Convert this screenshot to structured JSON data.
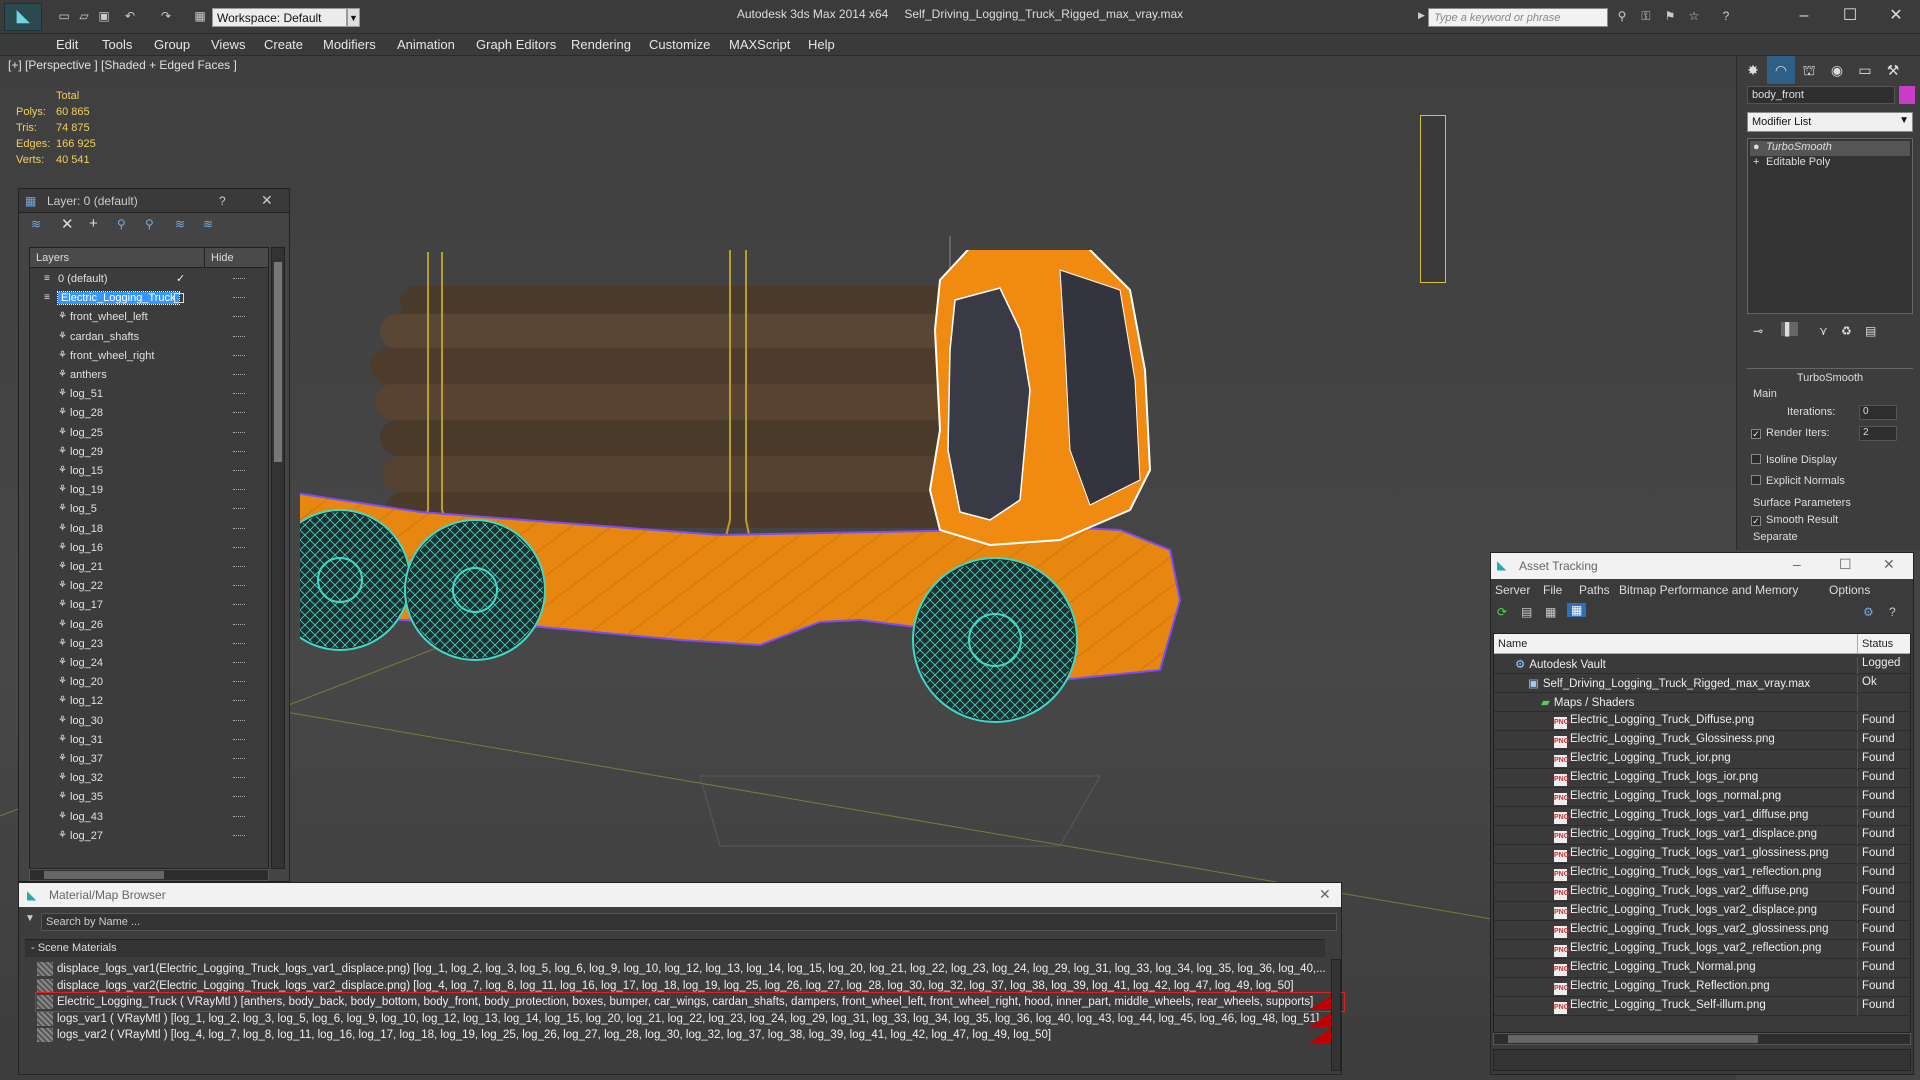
{
  "app": {
    "name": "Autodesk 3ds Max  2014 x64",
    "file": "Self_Driving_Logging_Truck_Rigged_max_vray.max",
    "workspace": "Workspace: Default",
    "search_placeholder": "Type a keyword or phrase"
  },
  "menu": [
    "Edit",
    "Tools",
    "Group",
    "Views",
    "Create",
    "Modifiers",
    "Animation",
    "Graph Editors",
    "Rendering",
    "Customize",
    "MAXScript",
    "Help"
  ],
  "viewport": {
    "label": "[+] [Perspective ] [Shaded + Edged Faces ]",
    "stats": {
      "header": "Total",
      "rows": [
        {
          "k": "Polys:",
          "v": "60 865"
        },
        {
          "k": "Tris:",
          "v": "74 875"
        },
        {
          "k": "Edges:",
          "v": "166 925"
        },
        {
          "k": "Verts:",
          "v": "40 541"
        }
      ]
    }
  },
  "command_panel": {
    "object_name": "body_front",
    "object_color": "#c83ec8",
    "modifier_list": "Modifier List",
    "stack": [
      "TurboSmooth",
      "Editable Poly"
    ],
    "rollout": "TurboSmooth",
    "main_label": "Main",
    "iterations_label": "Iterations:",
    "iterations": "0",
    "render_iters_label": "Render Iters:",
    "render_iters": "2",
    "isoline": "Isoline Display",
    "explicit": "Explicit Normals",
    "surface_label": "Surface Parameters",
    "smooth_result": "Smooth Result",
    "separate": "Separate"
  },
  "layer_panel": {
    "title": "Layer: 0 (default)",
    "help": "?",
    "col_layers": "Layers",
    "col_hide": "Hide",
    "rows": [
      {
        "name": "0 (default)",
        "level": 0,
        "selected": false,
        "check": true
      },
      {
        "name": "Electric_Logging_Truck",
        "level": 0,
        "selected": true,
        "check": false
      },
      {
        "name": "front_wheel_left",
        "level": 1
      },
      {
        "name": "cardan_shafts",
        "level": 1
      },
      {
        "name": "front_wheel_right",
        "level": 1
      },
      {
        "name": "anthers",
        "level": 1
      },
      {
        "name": "log_51",
        "level": 1
      },
      {
        "name": "log_28",
        "level": 1
      },
      {
        "name": "log_25",
        "level": 1
      },
      {
        "name": "log_29",
        "level": 1
      },
      {
        "name": "log_15",
        "level": 1
      },
      {
        "name": "log_19",
        "level": 1
      },
      {
        "name": "log_5",
        "level": 1
      },
      {
        "name": "log_18",
        "level": 1
      },
      {
        "name": "log_16",
        "level": 1
      },
      {
        "name": "log_21",
        "level": 1
      },
      {
        "name": "log_22",
        "level": 1
      },
      {
        "name": "log_17",
        "level": 1
      },
      {
        "name": "log_26",
        "level": 1
      },
      {
        "name": "log_23",
        "level": 1
      },
      {
        "name": "log_24",
        "level": 1
      },
      {
        "name": "log_20",
        "level": 1
      },
      {
        "name": "log_12",
        "level": 1
      },
      {
        "name": "log_30",
        "level": 1
      },
      {
        "name": "log_31",
        "level": 1
      },
      {
        "name": "log_37",
        "level": 1
      },
      {
        "name": "log_32",
        "level": 1
      },
      {
        "name": "log_35",
        "level": 1
      },
      {
        "name": "log_43",
        "level": 1
      },
      {
        "name": "log_27",
        "level": 1
      }
    ]
  },
  "material_browser": {
    "title": "Material/Map Browser",
    "search_placeholder": "Search by Name ...",
    "section": "- Scene Materials",
    "rows": [
      {
        "text": "displace_logs_var1(Electric_Logging_Truck_logs_var1_displace.png) [log_1, log_2, log_3, log_5, log_6, log_9, log_10, log_12, log_13, log_14, log_15, log_20, log_21, log_22, log_23, log_24, log_29, log_31, log_33, log_34, log_35, log_36, log_40,...",
        "highlight": false
      },
      {
        "text": "displace_logs_var2(Electric_Logging_Truck_logs_var2_displace.png) [log_4, log_7, log_8, log_11, log_16, log_17, log_18, log_19, log_25, log_26, log_27, log_28, log_30, log_32, log_37, log_38, log_39, log_41, log_42, log_47, log_49, log_50]",
        "highlight": false
      },
      {
        "text": "Electric_Logging_Truck ( VRayMtl ) [anthers, body_back, body_bottom, body_front, body_protection, boxes, bumper, car_wings, cardan_shafts, dampers, front_wheel_left, front_wheel_right, hood, inner_part, middle_wheels, rear_wheels, supports]",
        "highlight": true
      },
      {
        "text": "logs_var1 ( VRayMtl ) [log_1, log_2, log_3, log_5, log_6, log_9, log_10, log_12, log_13, log_14, log_15, log_20, log_21, log_22, log_23, log_24, log_29, log_31, log_33, log_34, log_35, log_36, log_40, log_43, log_44, log_45, log_46, log_48, log_51]",
        "highlight": false
      },
      {
        "text": "logs_var2 ( VRayMtl ) [log_4, log_7, log_8, log_11, log_16, log_17, log_18, log_19, log_25, log_26, log_27, log_28, log_30, log_32, log_37, log_38, log_39, log_41, log_42, log_47, log_49, log_50]",
        "highlight": false
      }
    ]
  },
  "asset_tracking": {
    "title": "Asset Tracking",
    "menu": [
      "Server",
      "File",
      "Paths",
      "Bitmap Performance and Memory",
      "Options"
    ],
    "col_name": "Name",
    "col_status": "Status",
    "rows": [
      {
        "name": "Autodesk Vault",
        "status": "Logged",
        "indent": 1,
        "icon": "vault"
      },
      {
        "name": "Self_Driving_Logging_Truck_Rigged_max_vray.max",
        "status": "Ok",
        "indent": 2,
        "icon": "max"
      },
      {
        "name": "Maps / Shaders",
        "status": "",
        "indent": 3,
        "icon": "folder"
      },
      {
        "name": "Electric_Logging_Truck_Diffuse.png",
        "status": "Found",
        "indent": 4,
        "icon": "png"
      },
      {
        "name": "Electric_Logging_Truck_Glossiness.png",
        "status": "Found",
        "indent": 4,
        "icon": "png"
      },
      {
        "name": "Electric_Logging_Truck_ior.png",
        "status": "Found",
        "indent": 4,
        "icon": "png"
      },
      {
        "name": "Electric_Logging_Truck_logs_ior.png",
        "status": "Found",
        "indent": 4,
        "icon": "png"
      },
      {
        "name": "Electric_Logging_Truck_logs_normal.png",
        "status": "Found",
        "indent": 4,
        "icon": "png"
      },
      {
        "name": "Electric_Logging_Truck_logs_var1_diffuse.png",
        "status": "Found",
        "indent": 4,
        "icon": "png"
      },
      {
        "name": "Electric_Logging_Truck_logs_var1_displace.png",
        "status": "Found",
        "indent": 4,
        "icon": "png"
      },
      {
        "name": "Electric_Logging_Truck_logs_var1_glossiness.png",
        "status": "Found",
        "indent": 4,
        "icon": "png"
      },
      {
        "name": "Electric_Logging_Truck_logs_var1_reflection.png",
        "status": "Found",
        "indent": 4,
        "icon": "png"
      },
      {
        "name": "Electric_Logging_Truck_logs_var2_diffuse.png",
        "status": "Found",
        "indent": 4,
        "icon": "png"
      },
      {
        "name": "Electric_Logging_Truck_logs_var2_displace.png",
        "status": "Found",
        "indent": 4,
        "icon": "png"
      },
      {
        "name": "Electric_Logging_Truck_logs_var2_glossiness.png",
        "status": "Found",
        "indent": 4,
        "icon": "png"
      },
      {
        "name": "Electric_Logging_Truck_logs_var2_reflection.png",
        "status": "Found",
        "indent": 4,
        "icon": "png"
      },
      {
        "name": "Electric_Logging_Truck_Normal.png",
        "status": "Found",
        "indent": 4,
        "icon": "png"
      },
      {
        "name": "Electric_Logging_Truck_Reflection.png",
        "status": "Found",
        "indent": 4,
        "icon": "png"
      },
      {
        "name": "Electric_Logging_Truck_Self-illum.png",
        "status": "Found",
        "indent": 4,
        "icon": "png"
      }
    ]
  },
  "colors": {
    "accent": "#3399ff",
    "truck": "#e8870f",
    "wire": "#7a4dff",
    "wheel": "#3fd9c8",
    "selection": "#c00000"
  }
}
